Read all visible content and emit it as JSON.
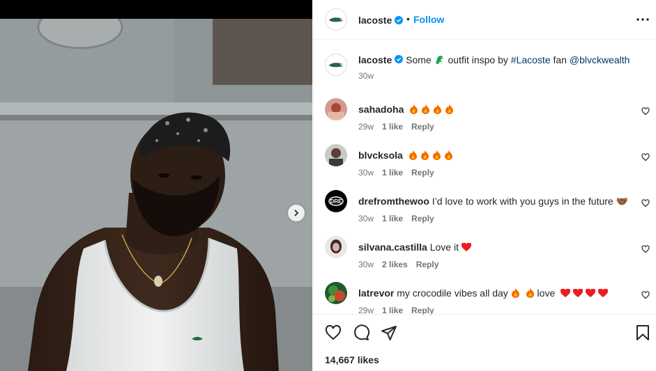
{
  "post": {
    "username": "lacoste",
    "follow_label": "Follow",
    "separator": "•",
    "caption": {
      "username": "lacoste",
      "text_before": "Some",
      "emoji": "crocodile-icon",
      "text_after": "outfit inspo by",
      "hashtag": "#Lacoste",
      "text_mid": "fan",
      "mention": "@blvckwealth",
      "time": "30w"
    },
    "likes": "14,667 likes"
  },
  "comments": [
    {
      "username": "sahadoha",
      "text": "",
      "emojis": [
        "fire",
        "fire",
        "fire",
        "fire"
      ],
      "time": "29w",
      "likes": "1 like",
      "reply": "Reply"
    },
    {
      "username": "blvcksola",
      "text": "",
      "emojis": [
        "fire",
        "fire",
        "fire",
        "fire"
      ],
      "time": "30w",
      "likes": "1 like",
      "reply": "Reply"
    },
    {
      "username": "drefromthewoo",
      "text": "I’d love to work with you guys in the future 🤝🏾",
      "emojis": [],
      "time": "30w",
      "likes": "1 like",
      "reply": "Reply"
    },
    {
      "username": "silvana.castilla",
      "text": "Love it",
      "emojis": [
        "red-heart"
      ],
      "time": "30w",
      "likes": "2 likes",
      "reply": "Reply"
    },
    {
      "username": "latrevor",
      "text": "my crocodile vibes all day",
      "text2": "love",
      "emojis": [
        "fire",
        "fire",
        "red-heart",
        "red-heart",
        "red-heart",
        "red-heart"
      ],
      "time": "29w",
      "likes": "1 like",
      "reply": "Reply"
    }
  ],
  "colors": {
    "accent": "#0095f6",
    "link": "#00376b",
    "muted": "#737373",
    "verified": "#0095f6",
    "fire": "#f56a00",
    "heart": "#ed1c24"
  }
}
